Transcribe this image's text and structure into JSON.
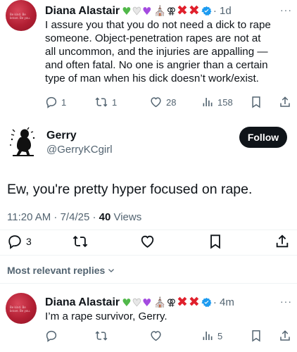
{
  "tweet1": {
    "author": "Diana Alastair",
    "badges": [
      "green-heart",
      "white-heart",
      "purple-heart",
      "church",
      "gender-symbol",
      "red-x",
      "red-x",
      "verified-badge"
    ],
    "gender_symbol": "⚢",
    "time": "1d",
    "text_lines": [
      "I assure you that you do not need a dick to rape",
      "someone. Object-penetration rapes are not at",
      "all uncommon, and the injuries are appalling —",
      "and often fatal. No one is angrier than a certain",
      "type of man when his dick doesn’t work/exist."
    ],
    "replies": "1",
    "reposts": "1",
    "likes": "28",
    "views": "158"
  },
  "main_tweet": {
    "author": "Gerry",
    "handle": "@GerryKCgirl",
    "follow_label": "Follow",
    "text": "Ew, you're pretty hyper focused on rape.",
    "time": "11:20 AM · 7/4/25 · ",
    "views_count": "40",
    "views_label": " Views",
    "replies": "3"
  },
  "sort": {
    "label": "Most relevant replies"
  },
  "tweet2": {
    "author": "Diana Alastair",
    "gender_symbol": "⚢",
    "time": "4m",
    "text": "I’m a rape survivor, Gerry.",
    "views": "5"
  },
  "avatar_shirt_text": "Be kind. Be brave. Be you.",
  "colors": {
    "accent": "#1d9bf0",
    "text": "#0f1419",
    "muted": "#536471",
    "red": "#e0202c"
  }
}
